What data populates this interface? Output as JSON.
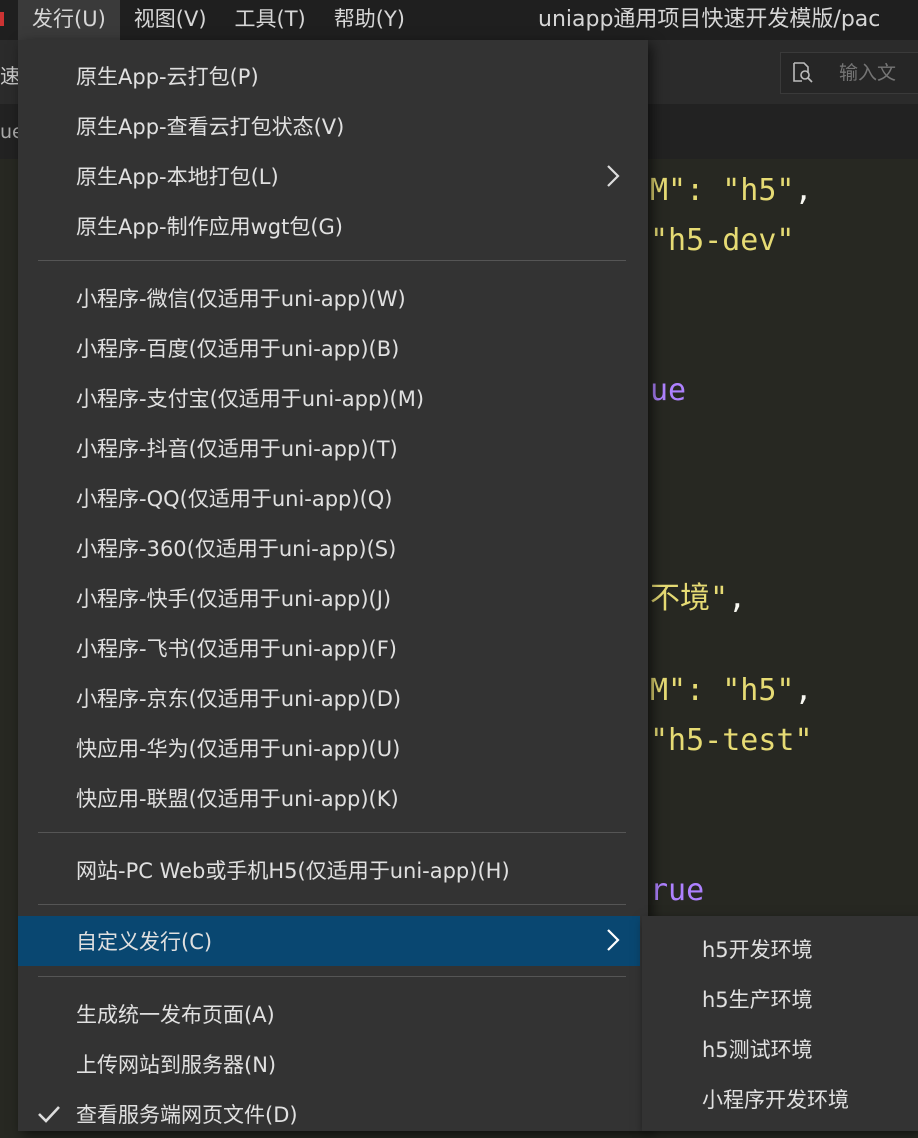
{
  "menubar": {
    "items": [
      "发行(U)",
      "视图(V)",
      "工具(T)",
      "帮助(Y)"
    ],
    "window_title": "uniapp通用项目快速开发模版/pac"
  },
  "toolbar": {
    "left_text": "速",
    "search_placeholder": "输入文",
    "search_icon": "search-file-icon"
  },
  "tabbar": {
    "left_text": "ue"
  },
  "editor": {
    "lines": [
      {
        "a": "M\": ",
        "b": "\"h5\"",
        "c": ","
      },
      {
        "a": "\"h5-dev\"",
        "b": "",
        "c": ""
      },
      {
        "a": "ue",
        "b": "",
        "c": ""
      },
      {
        "a": "不境\"",
        "b": "",
        "c": ","
      },
      {
        "a": "M\": ",
        "b": "\"h5\"",
        "c": ","
      },
      {
        "a": "\"h5-test\"",
        "b": "",
        "c": ""
      },
      {
        "a": "rue",
        "b": "",
        "c": ""
      }
    ]
  },
  "publish_menu": {
    "items": [
      {
        "label": "原生App-云打包(P)"
      },
      {
        "label": "原生App-查看云打包状态(V)"
      },
      {
        "label": "原生App-本地打包(L)",
        "submenu": true
      },
      {
        "label": "原生App-制作应用wgt包(G)"
      },
      {
        "label": "小程序-微信(仅适用于uni-app)(W)"
      },
      {
        "label": "小程序-百度(仅适用于uni-app)(B)"
      },
      {
        "label": "小程序-支付宝(仅适用于uni-app)(M)"
      },
      {
        "label": "小程序-抖音(仅适用于uni-app)(T)"
      },
      {
        "label": "小程序-QQ(仅适用于uni-app)(Q)"
      },
      {
        "label": "小程序-360(仅适用于uni-app)(S)"
      },
      {
        "label": "小程序-快手(仅适用于uni-app)(J)"
      },
      {
        "label": "小程序-飞书(仅适用于uni-app)(F)"
      },
      {
        "label": "小程序-京东(仅适用于uni-app)(D)"
      },
      {
        "label": "快应用-华为(仅适用于uni-app)(U)"
      },
      {
        "label": "快应用-联盟(仅适用于uni-app)(K)"
      },
      {
        "label": "网站-PC Web或手机H5(仅适用于uni-app)(H)"
      },
      {
        "label": "自定义发行(C)",
        "submenu": true,
        "highlighted": true
      },
      {
        "label": "生成统一发布页面(A)"
      },
      {
        "label": "上传网站到服务器(N)"
      },
      {
        "label": "查看服务端网页文件(D)",
        "checked": true
      }
    ]
  },
  "custom_submenu": {
    "items": [
      "h5开发环境",
      "h5生产环境",
      "h5测试环境",
      "小程序开发环境"
    ]
  },
  "colors": {
    "highlight": "#094771",
    "menu_bg": "#333333",
    "string": "#e6db74",
    "keyword": "#ae81ff"
  }
}
